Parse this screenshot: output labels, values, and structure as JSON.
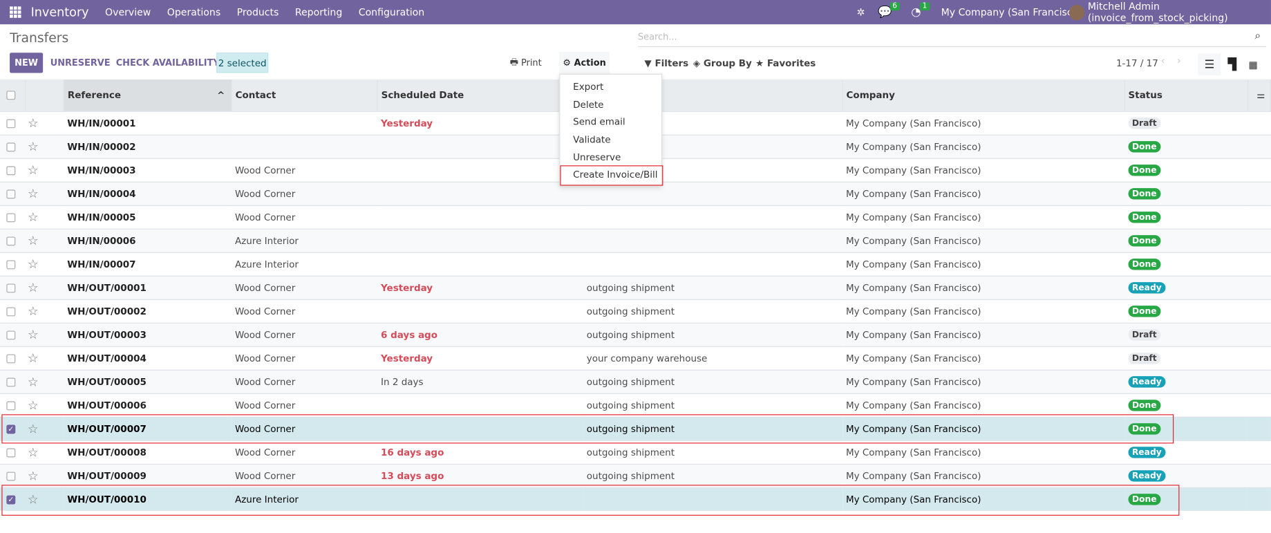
{
  "navbar": {
    "app": "Inventory",
    "menus": [
      "Overview",
      "Operations",
      "Products",
      "Reporting",
      "Configuration"
    ],
    "messages_count": "6",
    "activities_count": "1",
    "company": "My Company (San Francisco)",
    "user": "Mitchell Admin (invoice_from_stock_picking)"
  },
  "page": {
    "title": "Transfers",
    "new": "NEW",
    "unreserve": "UNRESERVE",
    "check_availability": "CHECK AVAILABILITY",
    "selected": "2 selected",
    "print": "Print",
    "action": "Action"
  },
  "search": {
    "placeholder": "Search..."
  },
  "toolbar": {
    "filters": "Filters",
    "group_by": "Group By",
    "favorites": "Favorites",
    "pager": "1-17 / 17"
  },
  "action_menu": [
    "Export",
    "Delete",
    "Send email",
    "Validate",
    "Unreserve",
    "Create Invoice/Bill"
  ],
  "columns": {
    "reference": "Reference",
    "contact": "Contact",
    "scheduled": "Scheduled Date",
    "source": "",
    "company": "Company",
    "status": "Status"
  },
  "rows": [
    {
      "ref": "WH/IN/00001",
      "contact": "",
      "date": "Yesterday",
      "late": true,
      "source": "",
      "company": "My Company (San Francisco)",
      "status": "Draft",
      "selected": false
    },
    {
      "ref": "WH/IN/00002",
      "contact": "",
      "date": "",
      "late": false,
      "source": "",
      "company": "My Company (San Francisco)",
      "status": "Done",
      "selected": false
    },
    {
      "ref": "WH/IN/00003",
      "contact": "Wood Corner",
      "date": "",
      "late": false,
      "source": "",
      "company": "My Company (San Francisco)",
      "status": "Done",
      "selected": false
    },
    {
      "ref": "WH/IN/00004",
      "contact": "Wood Corner",
      "date": "",
      "late": false,
      "source": "",
      "company": "My Company (San Francisco)",
      "status": "Done",
      "selected": false
    },
    {
      "ref": "WH/IN/00005",
      "contact": "Wood Corner",
      "date": "",
      "late": false,
      "source": "",
      "company": "My Company (San Francisco)",
      "status": "Done",
      "selected": false
    },
    {
      "ref": "WH/IN/00006",
      "contact": "Azure Interior",
      "date": "",
      "late": false,
      "source": "",
      "company": "My Company (San Francisco)",
      "status": "Done",
      "selected": false
    },
    {
      "ref": "WH/IN/00007",
      "contact": "Azure Interior",
      "date": "",
      "late": false,
      "source": "",
      "company": "My Company (San Francisco)",
      "status": "Done",
      "selected": false
    },
    {
      "ref": "WH/OUT/00001",
      "contact": "Wood Corner",
      "date": "Yesterday",
      "late": true,
      "source": "outgoing shipment",
      "company": "My Company (San Francisco)",
      "status": "Ready",
      "selected": false
    },
    {
      "ref": "WH/OUT/00002",
      "contact": "Wood Corner",
      "date": "",
      "late": false,
      "source": "outgoing shipment",
      "company": "My Company (San Francisco)",
      "status": "Done",
      "selected": false
    },
    {
      "ref": "WH/OUT/00003",
      "contact": "Wood Corner",
      "date": "6 days ago",
      "late": true,
      "source": "outgoing shipment",
      "company": "My Company (San Francisco)",
      "status": "Draft",
      "selected": false
    },
    {
      "ref": "WH/OUT/00004",
      "contact": "Wood Corner",
      "date": "Yesterday",
      "late": true,
      "source": "your company warehouse",
      "company": "My Company (San Francisco)",
      "status": "Draft",
      "selected": false
    },
    {
      "ref": "WH/OUT/00005",
      "contact": "Wood Corner",
      "date": "In 2 days",
      "late": false,
      "source": "outgoing shipment",
      "company": "My Company (San Francisco)",
      "status": "Ready",
      "selected": false
    },
    {
      "ref": "WH/OUT/00006",
      "contact": "Wood Corner",
      "date": "",
      "late": false,
      "source": "outgoing shipment",
      "company": "My Company (San Francisco)",
      "status": "Done",
      "selected": false
    },
    {
      "ref": "WH/OUT/00007",
      "contact": "Wood Corner",
      "date": "",
      "late": false,
      "source": "outgoing shipment",
      "company": "My Company (San Francisco)",
      "status": "Done",
      "selected": true
    },
    {
      "ref": "WH/OUT/00008",
      "contact": "Wood Corner",
      "date": "16 days ago",
      "late": true,
      "source": "outgoing shipment",
      "company": "My Company (San Francisco)",
      "status": "Ready",
      "selected": false
    },
    {
      "ref": "WH/OUT/00009",
      "contact": "Wood Corner",
      "date": "13 days ago",
      "late": true,
      "source": "outgoing shipment",
      "company": "My Company (San Francisco)",
      "status": "Ready",
      "selected": false
    },
    {
      "ref": "WH/OUT/00010",
      "contact": "Azure Interior",
      "date": "",
      "late": false,
      "source": "",
      "company": "My Company (San Francisco)",
      "status": "Done",
      "selected": true
    }
  ]
}
